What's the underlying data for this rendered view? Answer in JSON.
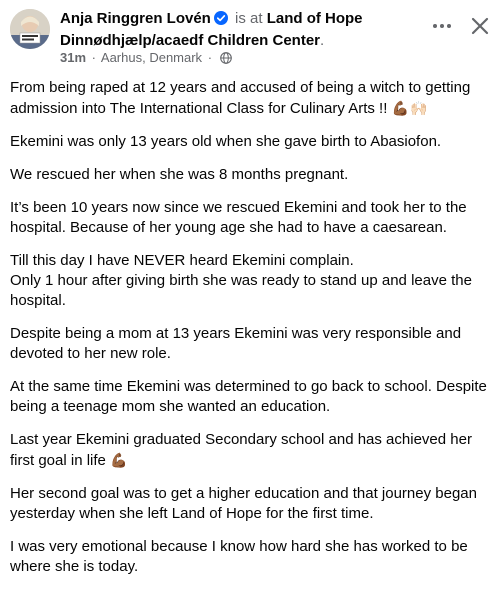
{
  "header": {
    "author_name": "Anja Ringgren Lovén",
    "is_at": "is at",
    "place_name": "Land of Hope Dinnødhjælp/acaedf Children Center",
    "time": "31m",
    "separator": "·",
    "location": "Aarhus, Denmark",
    "audience_icon": "globe-icon",
    "more_icon": "more-horizontal-icon",
    "close_icon": "close-icon",
    "verified_icon": "verified-badge-icon",
    "verified_color": "#0866ff"
  },
  "post": {
    "paragraphs": [
      {
        "text": "From being raped at 12 years and accused of being a witch to getting admission into The International Class for Culinary Arts !!",
        "emoji": "💪🏾🙌🏻"
      },
      {
        "text": "Ekemini was only 13 years old when she gave birth to Abasiofon.",
        "emoji": ""
      },
      {
        "text": "We rescued her when she was 8 months pregnant.",
        "emoji": ""
      },
      {
        "text": "It’s been 10 years now since we rescued Ekemini and took her to the hospital. Because of her young age she had to have a caesarean.",
        "emoji": ""
      },
      {
        "text": "Till this day I have NEVER heard Ekemini complain.\nOnly 1 hour after giving birth she was ready to stand up and leave the hospital.",
        "emoji": ""
      },
      {
        "text": "Despite being a mom at 13 years Ekemini was very responsible and devoted to her new role.",
        "emoji": ""
      },
      {
        "text": "At the same time Ekemini was determined to go back to school. Despite being a teenage mom she wanted an education.",
        "emoji": ""
      },
      {
        "text": "Last year Ekemini graduated Secondary school and has achieved her first goal in life",
        "emoji": "💪🏾"
      },
      {
        "text": "Her second goal was to get a higher education and that journey began yesterday when she left Land of Hope for the first time.",
        "emoji": ""
      },
      {
        "text": "I was very emotional because I know how hard she has worked to be where she is today.",
        "emoji": ""
      }
    ]
  }
}
